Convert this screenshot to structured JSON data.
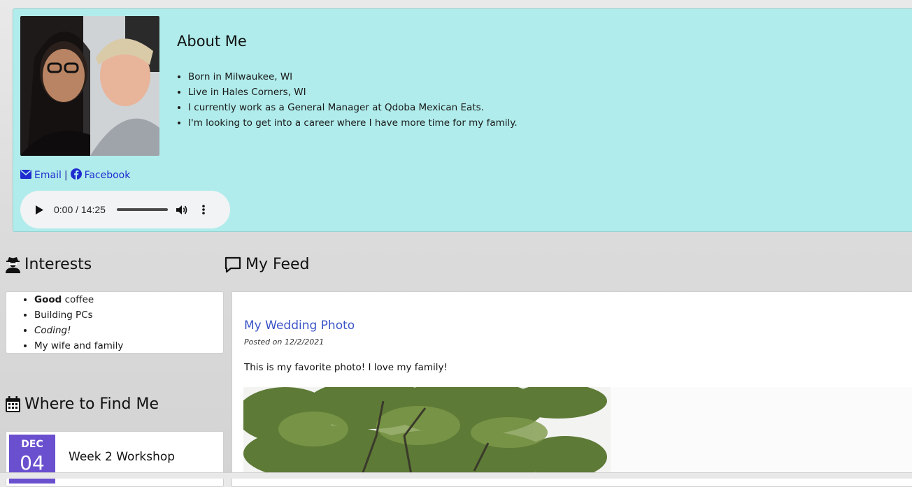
{
  "about": {
    "title": "About Me",
    "items": [
      "Born in Milwaukee, WI",
      "Live in Hales Corners, WI",
      "I currently work as a General Manager at Qdoba Mexican Eats.",
      "I'm looking to get into a career where I have more time for my family."
    ],
    "links": {
      "email": "Email",
      "separator": "|",
      "facebook": "Facebook"
    },
    "audio": {
      "time": "0:00 / 14:25",
      "progress": 0
    }
  },
  "interests": {
    "heading": "Interests",
    "items": [
      {
        "bold": "Good",
        "rest": " coffee"
      },
      {
        "text": "Building PCs"
      },
      {
        "italic": "Coding!"
      },
      {
        "text": "My wife and family"
      }
    ]
  },
  "find_me": {
    "heading": "Where to Find Me",
    "event": {
      "month": "DEC",
      "day": "04",
      "title": "Week 2 Workshop"
    }
  },
  "feed": {
    "heading": "My Feed",
    "post": {
      "title": "My Wedding Photo",
      "date": "Posted on 12/2/2021",
      "body": "This is my favorite photo! I love my family!"
    }
  },
  "colors": {
    "about_bg": "#b0eceb",
    "link": "#1f2bd0",
    "post_title": "#3b55c6",
    "date_badge": "#6a4fcf"
  }
}
